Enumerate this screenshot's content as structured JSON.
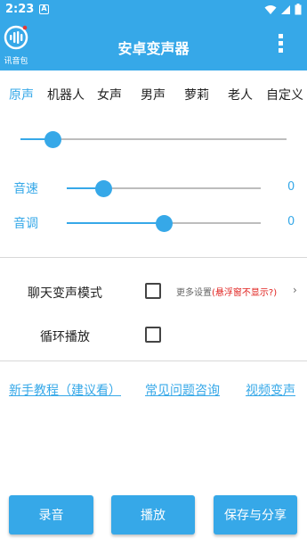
{
  "status": {
    "time": "2:23",
    "notif_letter": "A"
  },
  "header": {
    "logo_label": "讯音包",
    "title": "安卓变声器"
  },
  "tabs": [
    {
      "label": "原声",
      "active": true
    },
    {
      "label": "机器人",
      "active": false
    },
    {
      "label": "女声",
      "active": false
    },
    {
      "label": "男声",
      "active": false
    },
    {
      "label": "萝莉",
      "active": false
    },
    {
      "label": "老人",
      "active": false
    },
    {
      "label": "自定义",
      "active": false
    }
  ],
  "main_slider": {
    "value_fraction": 0.12
  },
  "speed": {
    "label": "音速",
    "value": "0",
    "fraction": 0.19
  },
  "pitch": {
    "label": "音调",
    "value": "0",
    "fraction": 0.5
  },
  "options": {
    "chat_mode_label": "聊天变声模式",
    "chat_mode_checked": false,
    "more_settings": "更多设置",
    "more_settings_warning": "(悬浮窗不显示?)",
    "loop_label": "循环播放",
    "loop_checked": false
  },
  "links": {
    "tutorial": "新手教程（建议看）",
    "faq": "常见问题咨询",
    "video": "视频变声"
  },
  "buttons": {
    "record": "录音",
    "play": "播放",
    "save_share": "保存与分享"
  },
  "colors": {
    "accent": "#36a8e8",
    "warning": "#e0201d"
  }
}
